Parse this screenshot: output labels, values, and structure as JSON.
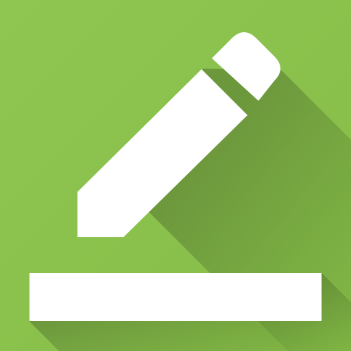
{
  "icon": {
    "name": "edit-icon",
    "depicts": [
      "pencil",
      "baseline-bar"
    ],
    "colors": {
      "background": "#8BC34A",
      "shadow": "#558B2F",
      "glyph": "#FFFFFF"
    }
  }
}
